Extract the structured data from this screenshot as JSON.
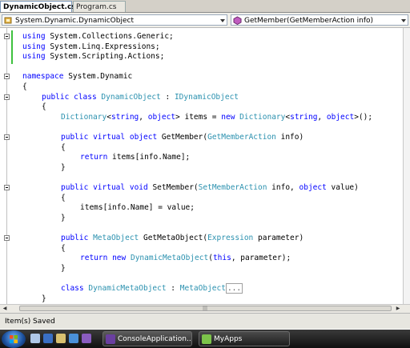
{
  "tabs": [
    {
      "label": "DynamicObject.cs",
      "active": true
    },
    {
      "label": "Program.cs",
      "active": false
    }
  ],
  "navbar": {
    "type_selector": "System.Dynamic.DynamicObject",
    "member_selector": "GetMember(GetMemberAction info)"
  },
  "code_lines": [
    [
      {
        "t": "using",
        "c": "kw"
      },
      {
        "t": " System.Collections.Generic;"
      }
    ],
    [
      {
        "t": "using",
        "c": "kw"
      },
      {
        "t": " System.Linq.Expressions;"
      }
    ],
    [
      {
        "t": "using",
        "c": "kw"
      },
      {
        "t": " System.Scripting.Actions;"
      }
    ],
    [],
    [
      {
        "t": "namespace",
        "c": "kw"
      },
      {
        "t": " System.Dynamic"
      }
    ],
    [
      {
        "t": "{"
      }
    ],
    [
      {
        "t": "public",
        "c": "kw"
      },
      {
        "t": " "
      },
      {
        "t": "class",
        "c": "kw"
      },
      {
        "t": " "
      },
      {
        "t": "DynamicObject",
        "c": "ty"
      },
      {
        "t": " : "
      },
      {
        "t": "IDynamicObject",
        "c": "ty"
      }
    ],
    [
      {
        "t": "{"
      }
    ],
    [
      {
        "t": "Dictionary",
        "c": "ty"
      },
      {
        "t": "<"
      },
      {
        "t": "string",
        "c": "kw"
      },
      {
        "t": ", "
      },
      {
        "t": "object",
        "c": "kw"
      },
      {
        "t": "> items = "
      },
      {
        "t": "new",
        "c": "kw"
      },
      {
        "t": " "
      },
      {
        "t": "Dictionary",
        "c": "ty"
      },
      {
        "t": "<"
      },
      {
        "t": "string",
        "c": "kw"
      },
      {
        "t": ", "
      },
      {
        "t": "object",
        "c": "kw"
      },
      {
        "t": ">();"
      }
    ],
    [],
    [
      {
        "t": "public",
        "c": "kw"
      },
      {
        "t": " "
      },
      {
        "t": "virtual",
        "c": "kw"
      },
      {
        "t": " "
      },
      {
        "t": "object",
        "c": "kw"
      },
      {
        "t": " GetMember("
      },
      {
        "t": "GetMemberAction",
        "c": "ty"
      },
      {
        "t": " info)"
      }
    ],
    [
      {
        "t": "{"
      }
    ],
    [
      {
        "t": "return",
        "c": "kw"
      },
      {
        "t": " items[info.Name];"
      }
    ],
    [
      {
        "t": "}"
      }
    ],
    [],
    [
      {
        "t": "public",
        "c": "kw"
      },
      {
        "t": " "
      },
      {
        "t": "virtual",
        "c": "kw"
      },
      {
        "t": " "
      },
      {
        "t": "void",
        "c": "kw"
      },
      {
        "t": " SetMember("
      },
      {
        "t": "SetMemberAction",
        "c": "ty"
      },
      {
        "t": " info, "
      },
      {
        "t": "object",
        "c": "kw"
      },
      {
        "t": " value)"
      }
    ],
    [
      {
        "t": "{"
      }
    ],
    [
      {
        "t": "items[info.Name] = value;"
      }
    ],
    [
      {
        "t": "}"
      }
    ],
    [],
    [
      {
        "t": "public",
        "c": "kw"
      },
      {
        "t": " "
      },
      {
        "t": "MetaObject",
        "c": "ty"
      },
      {
        "t": " GetMetaObject("
      },
      {
        "t": "Expression",
        "c": "ty"
      },
      {
        "t": " parameter)"
      }
    ],
    [
      {
        "t": "{"
      }
    ],
    [
      {
        "t": "return",
        "c": "kw"
      },
      {
        "t": " "
      },
      {
        "t": "new",
        "c": "kw"
      },
      {
        "t": " "
      },
      {
        "t": "DynamicMetaObject",
        "c": "ty"
      },
      {
        "t": "("
      },
      {
        "t": "this",
        "c": "kw"
      },
      {
        "t": ", parameter);"
      }
    ],
    [
      {
        "t": "}"
      }
    ],
    [],
    [
      {
        "t": "class",
        "c": "kw"
      },
      {
        "t": " "
      },
      {
        "t": "DynamicMetaObject",
        "c": "ty"
      },
      {
        "t": " : "
      },
      {
        "t": "MetaObject",
        "c": "ty"
      },
      {
        "t": "...",
        "c": "collapsed"
      }
    ],
    [
      {
        "t": "}"
      }
    ],
    [
      {
        "t": "}"
      }
    ]
  ],
  "status": {
    "text": "Item(s) Saved"
  },
  "taskbar": {
    "buttons": [
      {
        "label": "ConsoleApplication...",
        "icon": "visual-studio-icon"
      },
      {
        "label": "MyApps",
        "icon": "folder-icon"
      }
    ],
    "quick_launch": [
      "show-desktop-icon",
      "switch-windows-icon",
      "explorer-icon",
      "ie-icon",
      "media-icon"
    ]
  },
  "colors": {
    "keyword": "#0000ff",
    "type": "#2b91af",
    "modified_marker": "#3ec13e"
  }
}
